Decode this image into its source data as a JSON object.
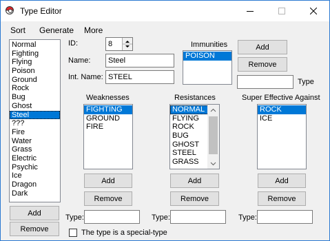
{
  "window": {
    "title": "Type Editor"
  },
  "menu": {
    "items": [
      "Sort",
      "Generate",
      "More"
    ]
  },
  "type_list": {
    "items": [
      "Normal",
      "Fighting",
      "Flying",
      "Poison",
      "Ground",
      "Rock",
      "Bug",
      "Ghost",
      "Steel",
      "???",
      "Fire",
      "Water",
      "Grass",
      "Electric",
      "Psychic",
      "Ice",
      "Dragon",
      "Dark"
    ],
    "selected": "Steel",
    "add_label": "Add",
    "remove_label": "Remove"
  },
  "fields": {
    "id_label": "ID:",
    "id_value": "8",
    "name_label": "Name:",
    "name_value": "Steel",
    "int_name_label": "Int. Name:",
    "int_name_value": "STEEL"
  },
  "immunities": {
    "label": "Immunities",
    "items": [
      "POISON"
    ],
    "add_label": "Add",
    "remove_label": "Remove",
    "type_label": "Type",
    "type_value": ""
  },
  "weaknesses": {
    "label": "Weaknesses",
    "items": [
      "FIGHTING",
      "GROUND",
      "FIRE"
    ],
    "add_label": "Add",
    "remove_label": "Remove",
    "type_label": "Type:",
    "type_value": ""
  },
  "resistances": {
    "label": "Resistances",
    "items": [
      "NORMAL",
      "FLYING",
      "ROCK",
      "BUG",
      "GHOST",
      "STEEL",
      "GRASS"
    ],
    "add_label": "Add",
    "remove_label": "Remove",
    "type_label": "Type:",
    "type_value": ""
  },
  "super_effective": {
    "label": "Super Effective Against",
    "items": [
      "ROCK",
      "ICE"
    ],
    "add_label": "Add",
    "remove_label": "Remove",
    "type_label": "Type:",
    "type_value": ""
  },
  "special_type": {
    "label": "The type is a special-type",
    "checked": false
  },
  "colors": {
    "selection": "#0078d7",
    "window_bg": "#f0f0f0",
    "border_accent": "#2b79d1"
  }
}
